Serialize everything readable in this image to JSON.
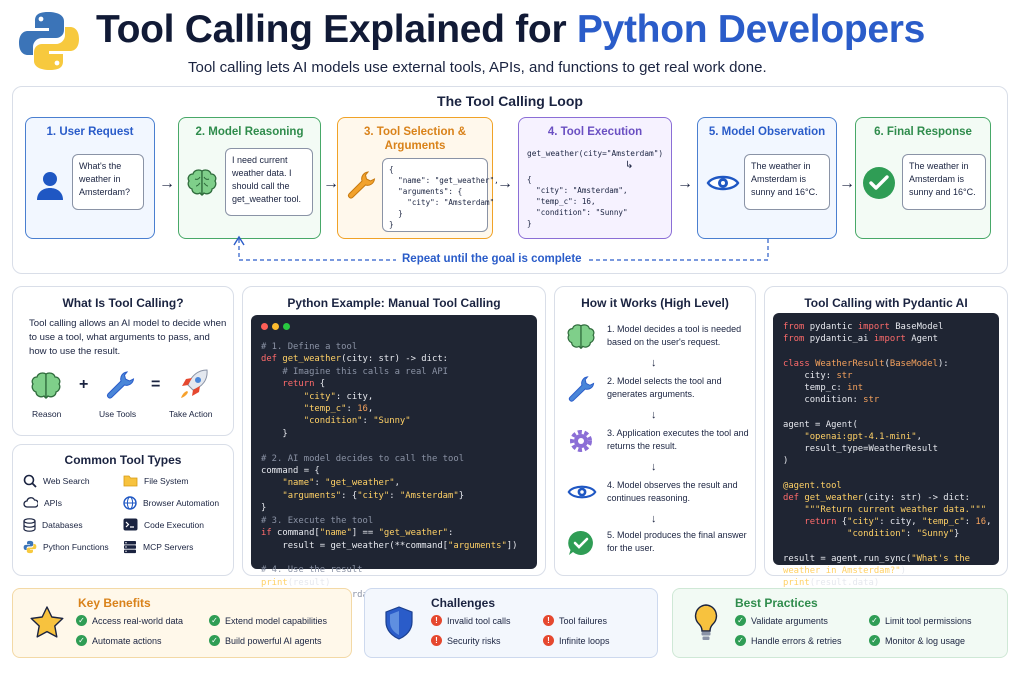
{
  "header": {
    "title_main": "Tool Calling Explained for ",
    "title_accent": "Python Developers",
    "subtitle": "Tool calling lets AI models use external tools, APIs, and functions to get real work done."
  },
  "loop": {
    "title": "The Tool Calling Loop",
    "repeat_label": "Repeat until the goal is complete",
    "steps": [
      {
        "title": "1. User Request",
        "text": "What's the weather in Amsterdam?"
      },
      {
        "title": "2. Model Reasoning",
        "text": "I need current weather data. I should call the get_weather tool."
      },
      {
        "title": "3. Tool Selection & Arguments",
        "code": "{\n  \"name\": \"get_weather\",\n  \"arguments\": {\n    \"city\": \"Amsterdam\"\n  }\n}"
      },
      {
        "title": "4. Tool Execution",
        "call": "get_weather(city=\"Amsterdam\")",
        "code": "{\n  \"city\": \"Amsterdam\",\n  \"temp_c\": 16,\n  \"condition\": \"Sunny\"\n}"
      },
      {
        "title": "5. Model Observation",
        "text": "The weather in Amsterdam is sunny and 16°C."
      },
      {
        "title": "6. Final Response",
        "text": "The weather in Amsterdam is sunny and 16°C."
      }
    ]
  },
  "what_is": {
    "title": "What Is Tool Calling?",
    "text": "Tool calling allows an AI model to decide when to use a tool, what arguments to pass, and how to use the result.",
    "reason": "Reason",
    "plus": "+",
    "use_tools": "Use Tools",
    "equals": "=",
    "take_action": "Take Action"
  },
  "tool_types": {
    "title": "Common Tool Types",
    "items": [
      "Web Search",
      "File System",
      "APIs",
      "Browser Automation",
      "Databases",
      "Code Execution",
      "Python Functions",
      "MCP Servers"
    ]
  },
  "python_example": {
    "title": "Python Example: Manual Tool Calling"
  },
  "how_it_works": {
    "title": "How it Works (High Level)",
    "steps": [
      "1. Model decides a tool is needed based on the user's request.",
      "2. Model selects the tool and generates arguments.",
      "3. Application executes the tool and returns the result.",
      "4. Model observes the result and continues reasoning.",
      "5. Model produces the final answer for the user."
    ]
  },
  "pydantic": {
    "title": "Tool Calling with Pydantic AI"
  },
  "benefits": {
    "title": "Key Benefits",
    "items": [
      "Access real-world data",
      "Extend model capabilities",
      "Automate actions",
      "Build powerful AI agents"
    ]
  },
  "challenges": {
    "title": "Challenges",
    "items": [
      "Invalid tool calls",
      "Tool failures",
      "Security risks",
      "Infinite loops"
    ]
  },
  "practices": {
    "title": "Best Practices",
    "items": [
      "Validate arguments",
      "Limit tool permissions",
      "Handle errors & retries",
      "Monitor & log usage"
    ]
  },
  "colors": {
    "navy": "#111a36",
    "accent_blue": "#2a5cc9",
    "green": "#2f9d55",
    "orange": "#f0a227",
    "purple": "#8b6ed6",
    "red": "#e5482f"
  }
}
